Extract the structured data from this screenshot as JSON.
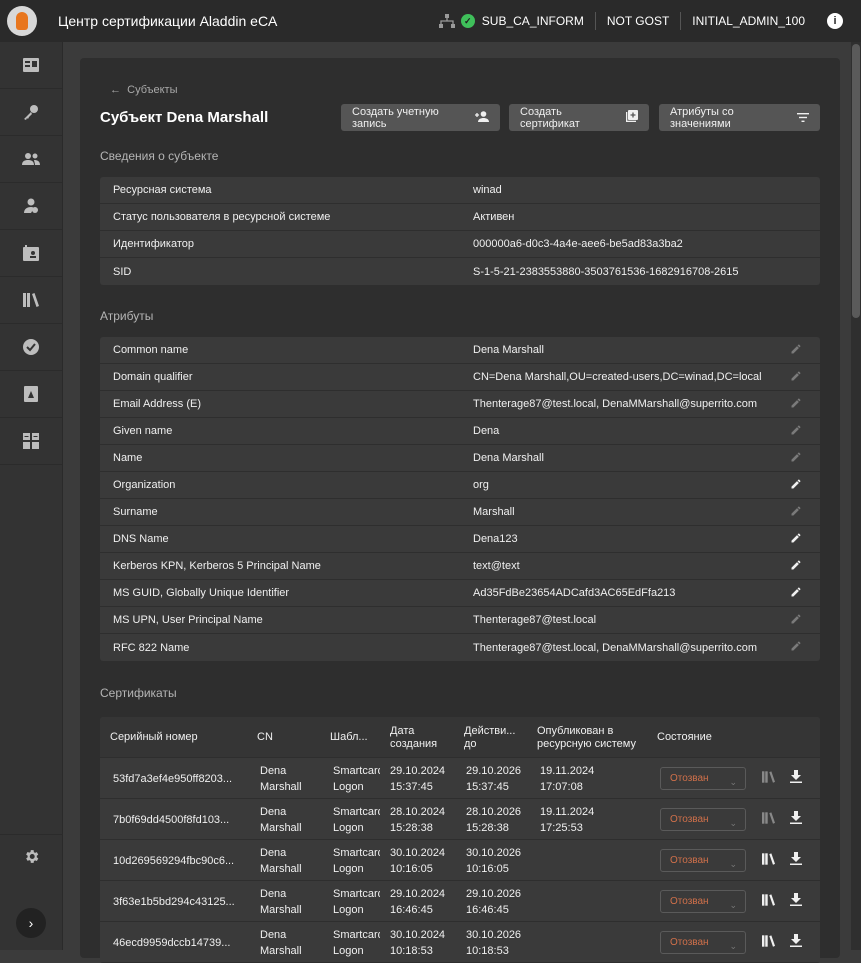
{
  "header": {
    "app_title": "Центр сертификации Aladdin eCA",
    "ca_name": "SUB_CA_INFORM",
    "gost_mode": "NOT GOST",
    "user": "INITIAL_ADMIN_100"
  },
  "page": {
    "breadcrumb": "Субъекты",
    "title": "Субъект Dena Marshall",
    "buttons": {
      "create_account": "Создать учетную запись",
      "create_cert": "Создать сертификат",
      "attrs_with_values": "Атрибуты со значениями"
    }
  },
  "subject_info": {
    "title": "Сведения о субъекте",
    "rows": [
      {
        "key": "Ресурсная система",
        "value": "winad"
      },
      {
        "key": "Статус пользователя в ресурсной системе",
        "value": "Активен"
      },
      {
        "key": "Идентификатор",
        "value": "000000a6-d0c3-4a4e-aee6-be5ad83a3ba2"
      },
      {
        "key": "SID",
        "value": "S-1-5-21-2383553880-3503761536-1682916708-2615"
      }
    ]
  },
  "attributes": {
    "title": "Атрибуты",
    "rows": [
      {
        "key": "Common name",
        "value": "Dena Marshall",
        "editable": false
      },
      {
        "key": "Domain qualifier",
        "value": "CN=Dena Marshall,OU=created-users,DC=winad,DC=local",
        "editable": false
      },
      {
        "key": "Email Address (E)",
        "value": "Thenterage87@test.local, DenaMMarshall@superrito.com",
        "editable": false
      },
      {
        "key": "Given name",
        "value": "Dena",
        "editable": false
      },
      {
        "key": "Name",
        "value": "Dena Marshall",
        "editable": false
      },
      {
        "key": "Organization",
        "value": "org",
        "editable": true
      },
      {
        "key": "Surname",
        "value": "Marshall",
        "editable": false
      },
      {
        "key": "DNS Name",
        "value": "Dena123",
        "editable": true
      },
      {
        "key": "Kerberos KPN, Kerberos 5 Principal Name",
        "value": "text@text",
        "editable": true
      },
      {
        "key": "MS GUID, Globally Unique Identifier",
        "value": "Ad35FdBe23654ADCafd3AC65EdFfa213",
        "editable": true
      },
      {
        "key": "MS UPN, User Principal Name",
        "value": "Thenterage87@test.local",
        "editable": false
      },
      {
        "key": "RFC 822 Name",
        "value": "Thenterage87@test.local, DenaMMarshall@superrito.com",
        "editable": false
      }
    ]
  },
  "certificates": {
    "title": "Сертификаты",
    "columns": {
      "serial": "Серийный номер",
      "cn": "CN",
      "template": "Шабл...",
      "created_1": "Дата",
      "created_2": "создания",
      "valid_1": "Действи...",
      "valid_2": "до",
      "published_1": "Опубликован в",
      "published_2": "ресурсную систему",
      "state": "Состояние"
    },
    "rows": [
      {
        "serial": "53fd7a3ef4e950ff8203...",
        "cn1": "Dena",
        "cn2": "Marshall",
        "t1": "Smartcard",
        "t2": "Logon",
        "c1": "29.10.2024",
        "c2": "15:37:45",
        "v1": "29.10.2026",
        "v2": "15:37:45",
        "p1": "19.11.2024",
        "p2": "17:07:08",
        "state": "Отозван",
        "lib_active": false
      },
      {
        "serial": "7b0f69dd4500f8fd103...",
        "cn1": "Dena",
        "cn2": "Marshall",
        "t1": "Smartcard",
        "t2": "Logon",
        "c1": "28.10.2024",
        "c2": "15:28:38",
        "v1": "28.10.2026",
        "v2": "15:28:38",
        "p1": "19.11.2024",
        "p2": "17:25:53",
        "state": "Отозван",
        "lib_active": false
      },
      {
        "serial": "10d269569294fbc90c6...",
        "cn1": "Dena",
        "cn2": "Marshall",
        "t1": "Smartcard",
        "t2": "Logon",
        "c1": "30.10.2024",
        "c2": "10:16:05",
        "v1": "30.10.2026",
        "v2": "10:16:05",
        "p1": "",
        "p2": "",
        "state": "Отозван",
        "lib_active": true
      },
      {
        "serial": "3f63e1b5bd294c43125...",
        "cn1": "Dena",
        "cn2": "Marshall",
        "t1": "Smartcard",
        "t2": "Logon",
        "c1": "29.10.2024",
        "c2": "16:46:45",
        "v1": "29.10.2026",
        "v2": "16:46:45",
        "p1": "",
        "p2": "",
        "state": "Отозван",
        "lib_active": true
      },
      {
        "serial": "46ecd9959dccb14739...",
        "cn1": "Dena",
        "cn2": "Marshall",
        "t1": "Smartcard",
        "t2": "Logon",
        "c1": "30.10.2024",
        "c2": "10:18:53",
        "v1": "30.10.2026",
        "v2": "10:18:53",
        "p1": "",
        "p2": "",
        "state": "Отозван",
        "lib_active": true
      }
    ]
  },
  "icons": {
    "org": "network-tree-icon",
    "ok": "check-circle-icon",
    "info": "info-icon",
    "edit": "pencil-icon",
    "library": "library-icon",
    "download": "download-icon",
    "settings": "gear-icon",
    "expand": "chevron-right-icon",
    "colors": {
      "accent_ok": "#3fbf5a",
      "revoked": "#d0704a"
    }
  }
}
